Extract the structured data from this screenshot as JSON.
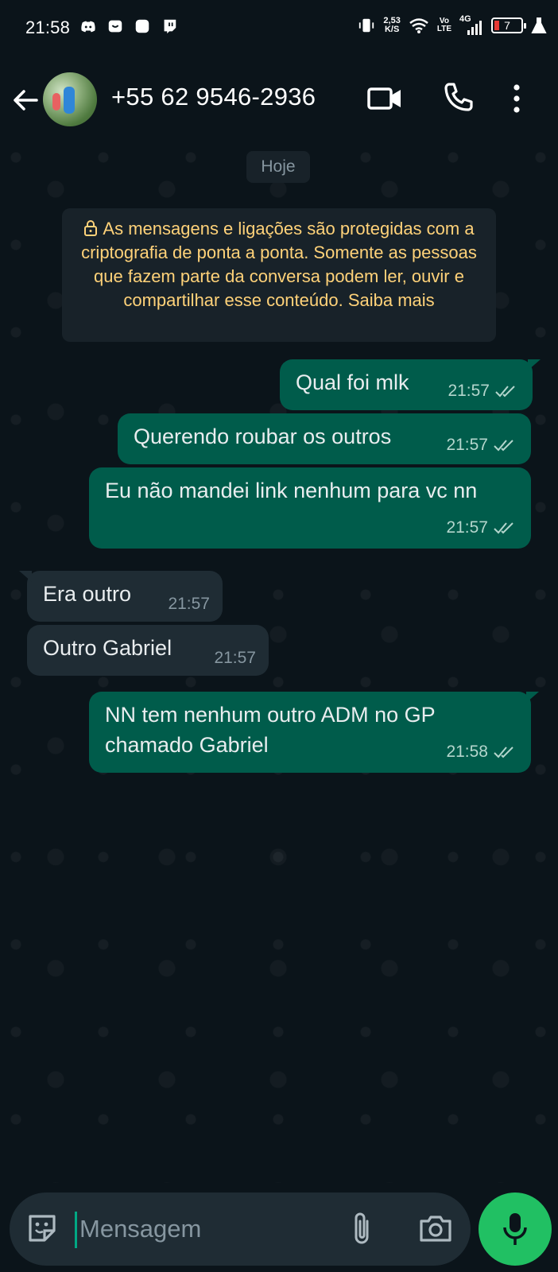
{
  "status_bar": {
    "time": "21:58",
    "net_speed_value": "2,53",
    "net_speed_unit": "K/S",
    "volte_top": "Vo",
    "volte_bottom": "LTE",
    "network": "4G",
    "battery_level": "7",
    "battery_color": "#e53935"
  },
  "header": {
    "contact_name": "+55 62 9546-2936",
    "icons": [
      "back-arrow-icon",
      "video-call-icon",
      "voice-call-icon",
      "more-options-icon"
    ]
  },
  "chat": {
    "day_label": "Hoje",
    "encryption_notice": "As mensagens e ligações são protegidas com a criptografia de ponta a ponta. Somente as pessoas que fazem parte da conversa podem ler, ouvir e compartilhar esse conteúdo. Saiba mais",
    "messages": [
      {
        "direction": "outgoing",
        "text": "Qual foi mlk",
        "time": "21:57",
        "status": "read"
      },
      {
        "direction": "outgoing",
        "text": "Querendo roubar os outros",
        "time": "21:57",
        "status": "read"
      },
      {
        "direction": "outgoing",
        "text": "Eu não mandei link nenhum para vc nn",
        "time": "21:57",
        "status": "read"
      },
      {
        "direction": "incoming",
        "text": "Era outro",
        "time": "21:57"
      },
      {
        "direction": "incoming",
        "text": "Outro Gabriel",
        "time": "21:57"
      },
      {
        "direction": "outgoing",
        "text": "NN tem nenhum outro ADM no GP chamado Gabriel",
        "time": "21:58",
        "status": "read"
      }
    ]
  },
  "composer": {
    "placeholder": "Mensagem",
    "value": "",
    "icons": [
      "emoji-sticker-icon",
      "attach-icon",
      "camera-icon",
      "microphone-icon"
    ]
  },
  "colors": {
    "background": "#0b141a",
    "outgoing_bubble": "#005c4b",
    "incoming_bubble": "#1f2c34",
    "notice_text": "#ffd279",
    "accent_green": "#21c063"
  }
}
